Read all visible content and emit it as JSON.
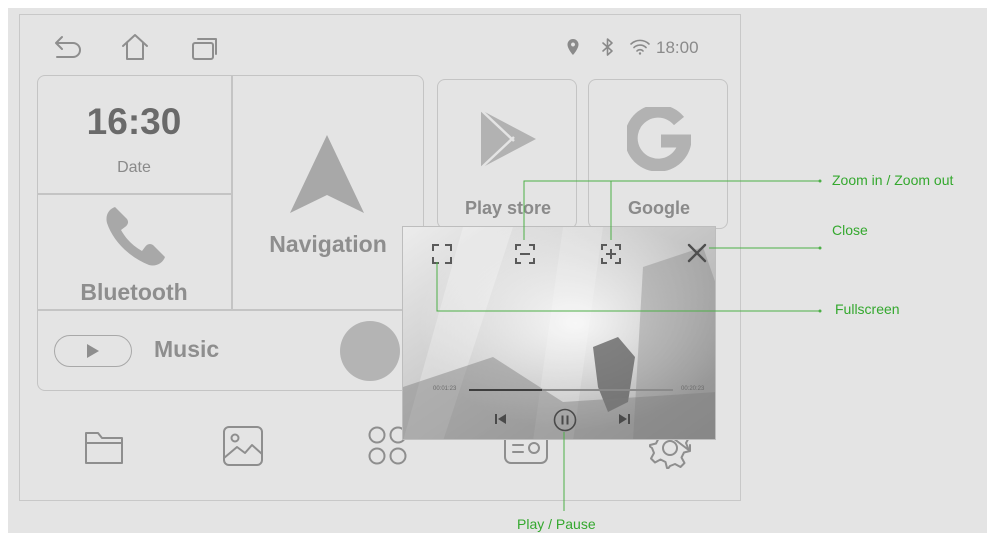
{
  "status_bar": {
    "time": "18:00"
  },
  "widgets": {
    "clock": {
      "time": "16:30",
      "date_label": "Date"
    },
    "bluetooth": {
      "label": "Bluetooth"
    },
    "navigation": {
      "label": "Navigation"
    },
    "music": {
      "label": "Music"
    },
    "play_store": {
      "label": "Play store"
    },
    "google": {
      "label": "Google"
    }
  },
  "video_popup": {
    "elapsed": "00:01:23",
    "total": "00:20:23",
    "progress": 0.36
  },
  "annotations": {
    "zoom": "Zoom in / Zoom out",
    "close": "Close",
    "fullscreen": "Fullscreen",
    "play_pause": "Play / Pause"
  },
  "colors": {
    "annotation": "#34a82e",
    "icon_gray": "#8e8e8e",
    "background": "#e4e4e4"
  }
}
